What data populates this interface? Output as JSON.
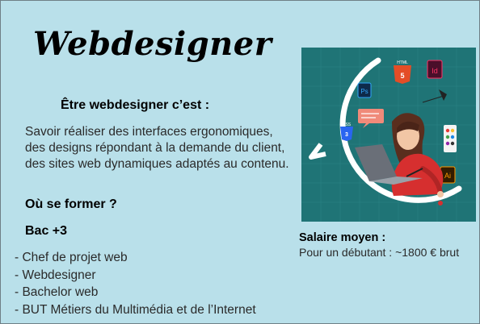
{
  "title": "Webdesigner",
  "intro_heading": "Être webdesigner c’est :",
  "description": [
    "Savoir réaliser des interfaces ergonomiques,",
    "des designs répondant à la demande du client,",
    "des sites web dynamiques adaptés au contenu."
  ],
  "training_heading": "Où se former ?",
  "level": "Bac +3",
  "jobs": [
    "- Chef de projet web",
    "- Webdesigner",
    "- Bachelor web",
    "- BUT Métiers du Multimédia et de l’Internet"
  ],
  "salary": {
    "heading": "Salaire moyen :",
    "text": "Pour un débutant : ~1800 € brut"
  },
  "illustration": {
    "html_label": "HTML",
    "css_label": "CSS",
    "ps_label": "Ps",
    "id_label": "Id",
    "ai_label": "Ai",
    "colors": {
      "background": "#1f7476",
      "accent_red": "#d62f2f",
      "ring": "#ffffff"
    }
  }
}
